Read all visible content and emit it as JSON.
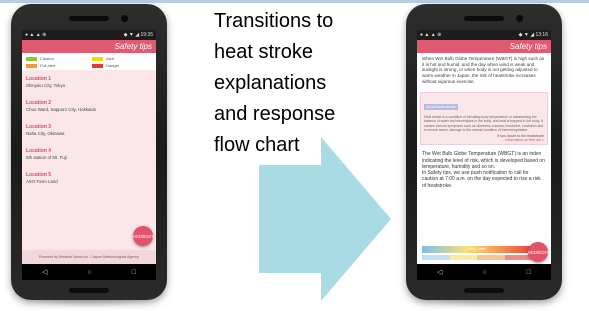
{
  "caption": {
    "lines": [
      "Transitions to",
      "heat stroke",
      "explanations",
      "and response",
      "flow chart"
    ]
  },
  "colors": {
    "app_pink": "#e05a72",
    "screen_bg": "#fbe7ea",
    "arrow": "#a9dbe4"
  },
  "left_phone": {
    "status": {
      "left": "● ▲ ▲ ⊕",
      "right": "◆ ▼ ◢ 19:35"
    },
    "logo": "Safety tips",
    "legend": [
      {
        "label": "Caution",
        "color": "#8dc63f"
      },
      {
        "label": "Alert",
        "color": "#f5d800"
      },
      {
        "label": "Full alert",
        "color": "#f39a36"
      },
      {
        "label": "Danger",
        "color": "#e53935"
      }
    ],
    "locations": [
      {
        "title": "Location 1",
        "address": "Shinjuku City, Tokyo",
        "value": "-"
      },
      {
        "title": "Location 2",
        "address": "Chuo Ward, Sapporo City, Hokkaido",
        "value": "-"
      },
      {
        "title": "Location 3",
        "address": "Naha City, Okinawa",
        "value": "-"
      },
      {
        "title": "Location 4",
        "address": "5th station of Mt. Fuji",
        "value": "-"
      },
      {
        "title": "Location 5",
        "address": "ASO Farm Land",
        "value": "-"
      }
    ],
    "footer": "Powered by Weather News Inc. / Japan Meteorological Agency",
    "fab_label": "ADD/EDIT",
    "nav": {
      "back": "◁",
      "home": "○",
      "recent": "□"
    }
  },
  "right_phone": {
    "status": {
      "left": "● ▲ ▲ ⊕",
      "right": "◆ ▼ ◢ 13:16"
    },
    "logo": "Safety tips",
    "intro": "When Wet Bulb Globe Temperature (WBGT) is high such as it is hot and humid, and the day when wind is weak and sunlight is strong, or when body is not getting adjusted to warm weather in Japan, the risk of heatstroke increases without vigorous exercise.",
    "box": {
      "title": "About heat stroke",
      "text": "Heat stroke is a condition of elevating body temperature or unbalancing the balance of water and electrolytes in the body, and heat is trapped in the body. It causes various symptoms such as dizziness, nausea, headache, confusion and in severe cases, damage to the natural condition of thermoregulation.",
      "question": "If you doubt to the heatstroke",
      "link": "→ Information on first aid >"
    },
    "section": "The Wet Bulb Globe Temperature (WBGT) is an index indicating the level of risk, which is developed based on temperature, humidity and so on.\nIn Safety tips, we use push notification to call for caution at 7:00 a.m. on the day expected to rise a risk of heatstroke.",
    "level_bar": "Risk Level",
    "fab_label": "ADD/EDIT",
    "nav": {
      "back": "◁",
      "home": "○",
      "recent": "□"
    }
  }
}
